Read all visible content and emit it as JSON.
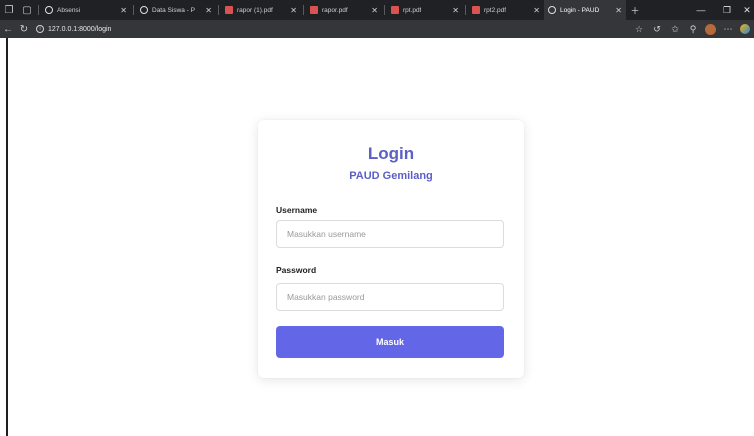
{
  "browser": {
    "tabs": [
      {
        "title": "Absensi",
        "icon": "globe-icon",
        "active": false
      },
      {
        "title": "Data Siswa - P",
        "icon": "globe-icon",
        "active": false
      },
      {
        "title": "rapor (1).pdf",
        "icon": "pdf-icon",
        "active": false
      },
      {
        "title": "rapor.pdf",
        "icon": "pdf-icon",
        "active": false
      },
      {
        "title": "rpt.pdf",
        "icon": "pdf-icon",
        "active": false
      },
      {
        "title": "rpt2.pdf",
        "icon": "pdf-icon",
        "active": false
      },
      {
        "title": "Login - PAUD",
        "icon": "globe-icon",
        "active": true
      }
    ],
    "url": "127.0.0.1:8000/login"
  },
  "login": {
    "title": "Login",
    "subtitle": "PAUD Gemilang",
    "username_label": "Username",
    "username_placeholder": "Masukkan username",
    "password_label": "Password",
    "password_placeholder": "Masukkan password",
    "submit_label": "Masuk"
  },
  "colors": {
    "accent": "#6366e6",
    "heading": "#5b5fc7",
    "chrome_dark": "#202124",
    "chrome_toolbar": "#35363a"
  }
}
